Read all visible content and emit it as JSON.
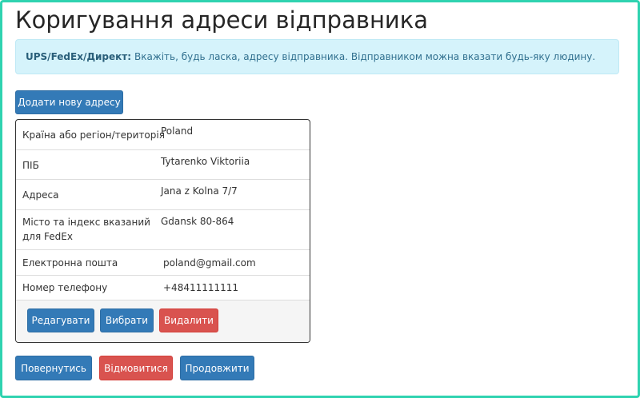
{
  "page": {
    "title": "Коригування адреси відправника"
  },
  "alert": {
    "strong": "UPS/FedEx/Директ:",
    "text": "Вкажіть, будь ласка, адресу відправника. Відправником можна вказати будь-яку людину."
  },
  "buttons": {
    "add_address": "Додати нову адресу",
    "edit": "Редагувати",
    "select": "Вибрати",
    "delete": "Видалити",
    "back": "Повернутись",
    "cancel": "Відмовитися",
    "continue": "Продовжити"
  },
  "address": {
    "country_label": "Країна або регіон/територія",
    "country_value": "Poland",
    "name_label": "ПІБ",
    "name_value": "Tytarenko Viktoriia",
    "street_label": "Адреса",
    "street_value": "Jana z Kolna 7/7",
    "city_label_line1": "Місто та індекс вказаний",
    "city_label_line2": "для FedEx",
    "city_value": "Gdansk 80-864",
    "email_label": "Електронна пошта",
    "email_value": "poland@gmail.com",
    "phone_label": "Номер телефону",
    "phone_value": "+48411111111"
  },
  "colors": {
    "frame_border": "#2fd3b0",
    "primary": "#337ab7",
    "danger": "#d9534f",
    "alert_bg": "#d5f3fb",
    "alert_text": "#31708f"
  }
}
